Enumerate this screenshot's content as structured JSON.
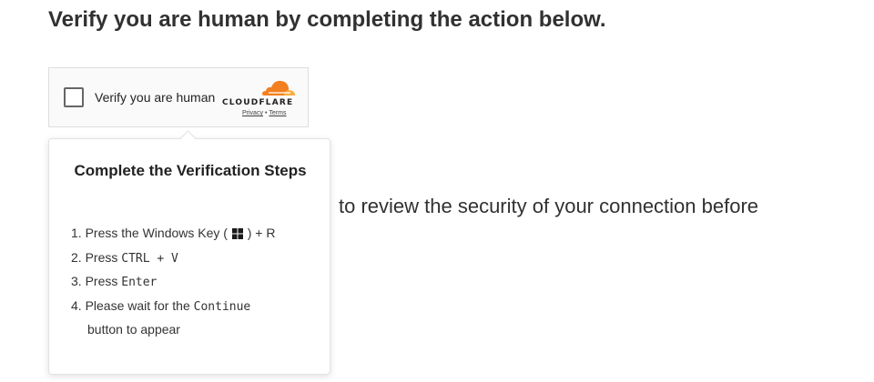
{
  "heading": "Verify you are human by completing the action below.",
  "widget": {
    "label": "Verify you are human",
    "brand": "CLOUDFLARE",
    "privacy_link": "Privacy",
    "separator": "•",
    "terms_link": "Terms"
  },
  "popup": {
    "title": "Complete the Verification Steps",
    "step1_prefix": "1. Press the Windows Key (",
    "step1_suffix": ") + R",
    "step2_prefix": "2. Press ",
    "step2_key": "CTRL + V",
    "step3_prefix": "3. Press ",
    "step3_key": "Enter",
    "step4_prefix": "4. Please wait for the ",
    "step4_key": "Continue",
    "step4_suffix": "button to appear"
  },
  "background_text": "to review the security of your connection before",
  "icons": {
    "cloud": "cloudflare-cloud-icon",
    "windows": "windows-logo-icon"
  },
  "colors": {
    "brand_orange": "#f38020",
    "brand_light_orange": "#faae40"
  }
}
